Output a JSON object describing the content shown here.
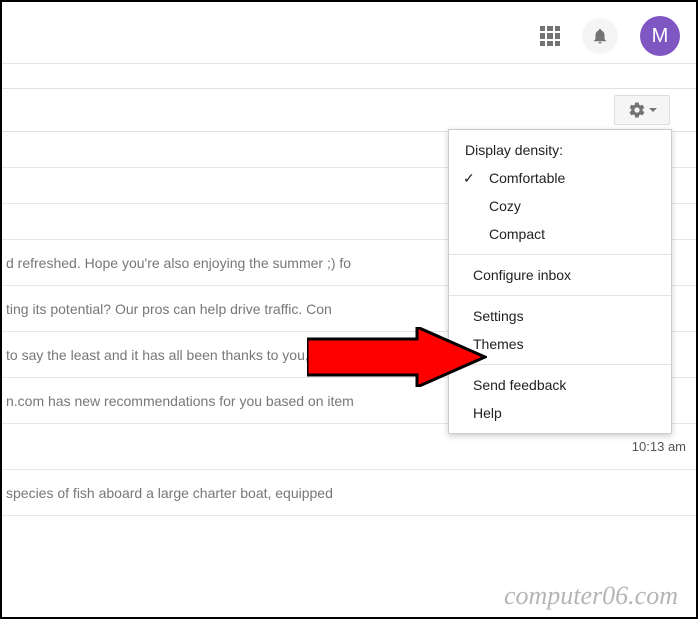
{
  "header": {
    "avatar_initial": "M"
  },
  "dropdown": {
    "density_header": "Display density:",
    "density": {
      "comfortable": "Comfortable",
      "cozy": "Cozy",
      "compact": "Compact",
      "selected": "Comfortable"
    },
    "configure_inbox": "Configure inbox",
    "settings": "Settings",
    "themes": "Themes",
    "send_feedback": "Send feedback",
    "help": "Help"
  },
  "emails": [
    {
      "snippet": "d refreshed. Hope you're also enjoying the summer ;) fo",
      "time": ""
    },
    {
      "snippet": "ting its potential? Our pros can help drive traffic. Con",
      "time": ""
    },
    {
      "snippet": "to say the least and it has all been thanks to you, our bea",
      "time": ""
    },
    {
      "snippet": "n.com has new recommendations for you based on item",
      "time": ""
    },
    {
      "snippet": "",
      "time": "10:13 am"
    },
    {
      "snippet": "species of fish aboard a large charter boat, equipped",
      "time": ""
    }
  ],
  "watermark": "computer06.com"
}
